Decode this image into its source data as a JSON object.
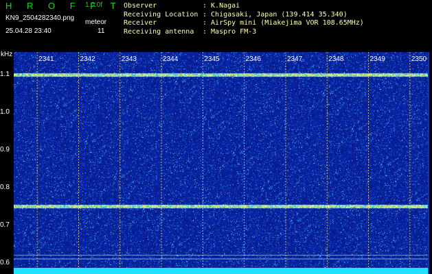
{
  "header": {
    "logo": "H R O F F T",
    "version": "1.0.0f",
    "filename": "KN9_2504282340.png",
    "datetime": "25.04.28 23:40",
    "meteor_label": "meteor",
    "meteor_count": "11"
  },
  "info": [
    {
      "key": "Observer",
      "value": ": K.Nagai"
    },
    {
      "key": "Receiving Location",
      "value": ": Chigasaki, Japan (139.414 35.340)"
    },
    {
      "key": "Receiver",
      "value": ": AirSpy mini (Miakejima VOR 108.65MHz)"
    },
    {
      "key": "Receiving antenna",
      "value": ": Maspro FM-3"
    }
  ],
  "axis": {
    "y_unit": "kHz",
    "y_ticks": [
      "1.1",
      "1.0",
      "0.9",
      "0.8",
      "0.7",
      "0.6"
    ],
    "x_ticks": [
      "2341",
      "2342",
      "2343",
      "2344",
      "2345",
      "2346",
      "2347",
      "2348",
      "2349",
      "2350"
    ]
  },
  "chart_data": {
    "type": "heatmap",
    "xlabel": "",
    "ylabel": "kHz",
    "x_ticks": [
      "2341",
      "2342",
      "2343",
      "2344",
      "2345",
      "2346",
      "2347",
      "2348",
      "2349",
      "2350"
    ],
    "y_ticks": [
      1.1,
      1.0,
      0.9,
      0.8,
      0.7,
      0.6
    ],
    "ylim": [
      0.57,
      1.16
    ],
    "lines_khz": [
      1.1,
      0.75,
      0.62,
      0.61
    ]
  },
  "colors": {
    "background": "#0a1a8a",
    "logo": "#1fd21f",
    "info_text": "#ffffb4",
    "signal_line": "#b0ff40",
    "bottom_bar": "#20e0ff"
  }
}
